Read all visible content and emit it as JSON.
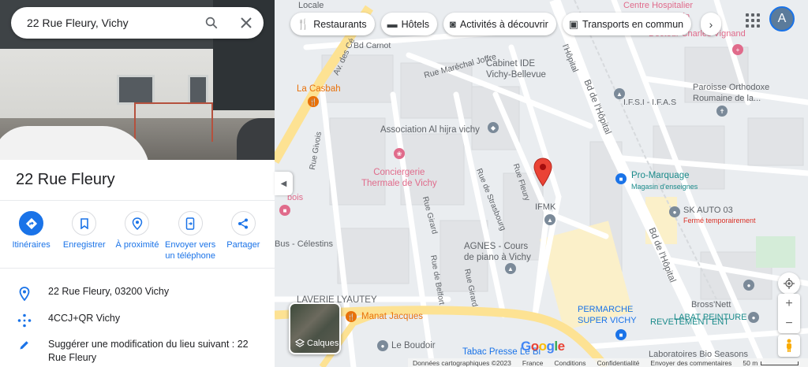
{
  "search": {
    "query": "22 Rue Fleury, Vichy"
  },
  "place": {
    "title": "22 Rue Fleury"
  },
  "actions": [
    {
      "label": "Itinéraires",
      "icon": "directions-icon"
    },
    {
      "label": "Enregistrer",
      "icon": "bookmark-icon"
    },
    {
      "label": "À proximité",
      "icon": "nearby-icon"
    },
    {
      "label": "Envoyer vers un téléphone",
      "icon": "send-to-phone-icon"
    },
    {
      "label": "Partager",
      "icon": "share-icon"
    }
  ],
  "info": {
    "address": "22 Rue Fleury, 03200 Vichy",
    "plus_code": "4CCJ+QR Vichy",
    "suggest": "Suggérer une modification du lieu suivant : 22 Rue Fleury"
  },
  "chips": [
    {
      "label": "Restaurants",
      "icon": "restaurant-icon"
    },
    {
      "label": "Hôtels",
      "icon": "hotel-icon"
    },
    {
      "label": "Activités à découvrir",
      "icon": "camera-icon"
    },
    {
      "label": "Transports en commun",
      "icon": "transit-icon"
    }
  ],
  "account": {
    "initial": "A"
  },
  "map": {
    "streets": {
      "bd_carnot": "Bd Carnot",
      "rue_marechal_joffre": "Rue Maréchal Joffre",
      "av_des_celestins": "Av. des Cé",
      "bd_hopital_1": "Bd de l'Hôpital",
      "bd_hopital_2": "Bd de l'Hôpital",
      "bd_hopital_3": "Bd de l'Hôpital",
      "rue_givois": "Rue Givois",
      "rue_girard": "Rue Girard",
      "rue_strasbourg": "Rue de Strasbourg",
      "rue_fleury": "Rue Fleury",
      "rue_belfort": "Rue de Belfort",
      "rue_girard2": "Rue Girard",
      "bd_hopital_top": "l'Hôpital",
      "locale": "Locale"
    },
    "pois": {
      "centre_hospitalier": "Centre Hospitalier\nJacques Lacarin",
      "docteur": "Docteur Charles Vignand",
      "cabinet": "Cabinet IDE\nVichy-Bellevue",
      "ifsi": "I.F.S.I - I.F.A.S",
      "paroisse": "Paroisse Orthodoxe\nRoumaine de la...",
      "la_casbah": "La Casbah",
      "association": "Association Al hijra vichy",
      "conciergerie": "Conciergerie\nThermale de Vichy",
      "pro_marquage": "Pro-Marquage",
      "pro_marquage_sub": "Magasin d'enseignes",
      "ifmk": "IFMK",
      "sk_auto": "SK AUTO 03",
      "sk_auto_sub": "Fermé temporairement",
      "bus_celestins": "Bus - Célestins",
      "agnes": "AGNES - Cours\nde piano à Vichy",
      "laverie": "LAVERIE LYAUTEY",
      "manat": "Manat Jacques",
      "bross": "Bross'Nett",
      "labat": "LABAT PEINTURE",
      "super_vichy": "PERMARCHE\nSUPER VICHY",
      "revetement": "REVETEMENT ENT",
      "le_boudoir": "Le Boudoir",
      "tabac": "Tabac Presse Le Bi",
      "bio_seasons": "Laboratoires Bio Seasons",
      "bois": "bois"
    },
    "layers_label": "Calques",
    "google": "Google"
  },
  "footer": {
    "data": "Données cartographiques ©2023",
    "country": "France",
    "terms": "Conditions",
    "privacy": "Confidentialité",
    "feedback": "Envoyer des commentaires",
    "scale": "50 m"
  },
  "colors": {
    "accent": "#1a73e8",
    "pin": "#ea4335",
    "road_major": "#fde293",
    "poi_pink": "#e06b8b",
    "poi_teal": "#1a8a8a",
    "poi_orange": "#e8710a"
  }
}
